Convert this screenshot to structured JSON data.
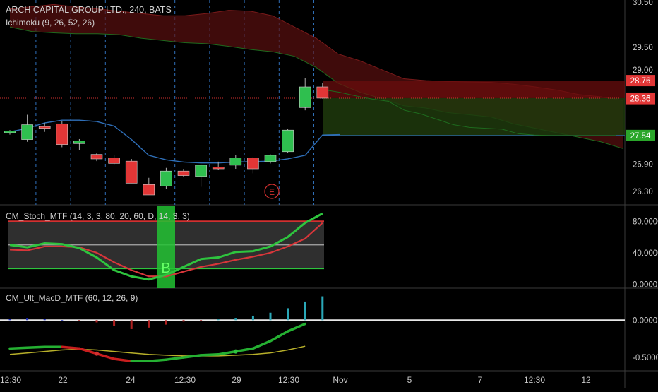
{
  "header": {
    "symbol_line": "ARCH CAPITAL GROUP LTD., 240, BATS",
    "indicator_line": "Ichimoku (9, 26, 52, 26)"
  },
  "panels": {
    "stoch_title": "CM_Stoch_MTF (14, 3, 3, 80, 20, 60, D, 14, 3, 3)",
    "macd_title": "CM_Ult_MacD_MTF (60, 12, 26, 9)"
  },
  "colors": {
    "background": "#000000",
    "grid": "#1f2a3a",
    "axis_text": "#c8c8c8",
    "bull": "#2fbf4f",
    "bear": "#e23636",
    "kijun": "#2f6fb8",
    "stoch_k": "#2ec43e",
    "stoch_d": "#d8363a",
    "macd_fast": "#25b032",
    "macd_signal": "#b8b02a",
    "hist_pos": "#2aa8b8",
    "hist_neg": "#b02020",
    "hist_neg_blue": "#1c2ec0"
  },
  "chart_data": [
    {
      "type": "candlestick",
      "title": "ARCH CAPITAL GROUP LTD., 240, BATS",
      "x_ticks": [
        "12:30",
        "22",
        "24",
        "12:30",
        "29",
        "12:30",
        "Nov",
        "5",
        "7",
        "12:30",
        "12"
      ],
      "y_ticks": [
        26.3,
        26.9,
        29.0,
        29.5,
        30.5
      ],
      "ylim": [
        26.0,
        30.55
      ],
      "price_labels": [
        {
          "text": "28.76",
          "value": 28.76,
          "color": "#e23636"
        },
        {
          "text": "28.37",
          "value": 28.37,
          "color": "#505050"
        },
        {
          "text": "28.36",
          "value": 28.36,
          "color": "#e23636"
        },
        {
          "text": "27.54",
          "value": 27.54,
          "color": "#2aa62a"
        }
      ],
      "candles": [
        {
          "o": 27.6,
          "h": 27.66,
          "l": 27.56,
          "c": 27.64
        },
        {
          "o": 27.45,
          "h": 28.0,
          "l": 27.4,
          "c": 27.78
        },
        {
          "o": 27.74,
          "h": 27.82,
          "l": 27.62,
          "c": 27.7
        },
        {
          "o": 27.8,
          "h": 27.86,
          "l": 27.28,
          "c": 27.34
        },
        {
          "o": 27.36,
          "h": 27.46,
          "l": 27.22,
          "c": 27.42
        },
        {
          "o": 27.12,
          "h": 27.16,
          "l": 26.97,
          "c": 27.02
        },
        {
          "o": 27.04,
          "h": 27.1,
          "l": 26.9,
          "c": 26.92
        },
        {
          "o": 26.97,
          "h": 27.02,
          "l": 26.48,
          "c": 26.48
        },
        {
          "o": 26.45,
          "h": 26.6,
          "l": 26.22,
          "c": 26.22
        },
        {
          "o": 26.42,
          "h": 26.82,
          "l": 26.36,
          "c": 26.75
        },
        {
          "o": 26.75,
          "h": 26.8,
          "l": 26.62,
          "c": 26.65
        },
        {
          "o": 26.63,
          "h": 26.9,
          "l": 26.4,
          "c": 26.88
        },
        {
          "o": 26.84,
          "h": 26.96,
          "l": 26.78,
          "c": 26.8
        },
        {
          "o": 26.88,
          "h": 27.1,
          "l": 26.8,
          "c": 27.04
        },
        {
          "o": 27.04,
          "h": 27.06,
          "l": 26.7,
          "c": 26.8
        },
        {
          "o": 26.96,
          "h": 27.12,
          "l": 26.92,
          "c": 27.1
        },
        {
          "o": 27.18,
          "h": 27.68,
          "l": 27.16,
          "c": 27.66
        },
        {
          "o": 28.16,
          "h": 28.82,
          "l": 28.1,
          "c": 28.62
        },
        {
          "o": 28.62,
          "h": 28.7,
          "l": 28.36,
          "c": 28.37
        }
      ],
      "kijun": [
        27.62,
        27.7,
        27.82,
        27.88,
        27.88,
        27.85,
        27.75,
        27.45,
        27.1,
        27.0,
        26.95,
        26.93,
        26.93,
        26.95,
        26.96,
        26.97,
        27.02,
        27.1,
        27.55,
        27.56
      ],
      "senkou_a": [
        30.35,
        30.4,
        30.45,
        30.4,
        30.35,
        30.3,
        30.25,
        30.2,
        30.2,
        30.25,
        30.32,
        30.3,
        30.2,
        29.95,
        29.7,
        29.35,
        29.2,
        29.0,
        28.8,
        28.76,
        28.74,
        28.73,
        28.72,
        28.68,
        28.62,
        28.55,
        28.45,
        28.4,
        28.32
      ],
      "senkou_b": [
        29.95,
        29.85,
        29.82,
        29.8,
        29.8,
        29.78,
        29.7,
        29.65,
        29.6,
        29.58,
        29.52,
        29.45,
        29.4,
        29.3,
        29.05,
        28.7,
        28.5,
        28.36,
        28.2,
        28.15,
        28.05,
        28.0,
        27.95,
        27.8,
        27.7,
        27.6,
        27.5,
        27.4,
        27.25
      ],
      "lagging": [
        28.56,
        28.5,
        28.42,
        28.35,
        28.3,
        28.1,
        28.02,
        27.9,
        27.78,
        27.72,
        27.7,
        27.68,
        27.58,
        27.55,
        27.54,
        27.54,
        27.54,
        27.54,
        27.54
      ],
      "earnings_marker": "E"
    },
    {
      "type": "line",
      "title": "CM_Stoch_MTF (14, 3, 3, 80, 20, 60, D, 14, 3, 3)",
      "y_ticks": [
        "80.0000",
        "40.0000",
        "0.0000"
      ],
      "ylim": [
        -5,
        100
      ],
      "upper_band": 80,
      "lower_band": 20,
      "mid_line": 50,
      "signal_label": "B",
      "series": [
        {
          "values": [
            50,
            47,
            52,
            51,
            46,
            34,
            18,
            10,
            6,
            12,
            22,
            32,
            34,
            41,
            42,
            48,
            60,
            78,
            90
          ]
        },
        {
          "values": [
            44,
            43,
            48,
            48,
            47,
            40,
            28,
            18,
            10,
            10,
            16,
            22,
            26,
            31,
            35,
            40,
            48,
            58,
            78
          ]
        }
      ]
    },
    {
      "type": "bar",
      "title": "CM_Ult_MacD_MTF (60, 12, 26, 9)",
      "y_ticks": [
        "0.0000",
        "-0.5000"
      ],
      "ylim": [
        -0.68,
        0.42
      ],
      "histogram": [
        0.02,
        0.03,
        0.02,
        0.0,
        -0.01,
        -0.03,
        -0.08,
        -0.12,
        -0.1,
        -0.06,
        -0.02,
        -0.01,
        0.01,
        0.03,
        0.06,
        0.1,
        0.16,
        0.25,
        0.32
      ],
      "series": [
        {
          "values": [
            -0.38,
            -0.37,
            -0.36,
            -0.36,
            -0.38,
            -0.45,
            -0.52,
            -0.55,
            -0.55,
            -0.53,
            -0.5,
            -0.47,
            -0.46,
            -0.42,
            -0.38,
            -0.28,
            -0.15,
            -0.05
          ]
        },
        {
          "values": [
            -0.46,
            -0.44,
            -0.42,
            -0.4,
            -0.39,
            -0.4,
            -0.42,
            -0.44,
            -0.46,
            -0.47,
            -0.48,
            -0.48,
            -0.48,
            -0.47,
            -0.46,
            -0.44,
            -0.4,
            -0.35
          ]
        }
      ]
    }
  ]
}
